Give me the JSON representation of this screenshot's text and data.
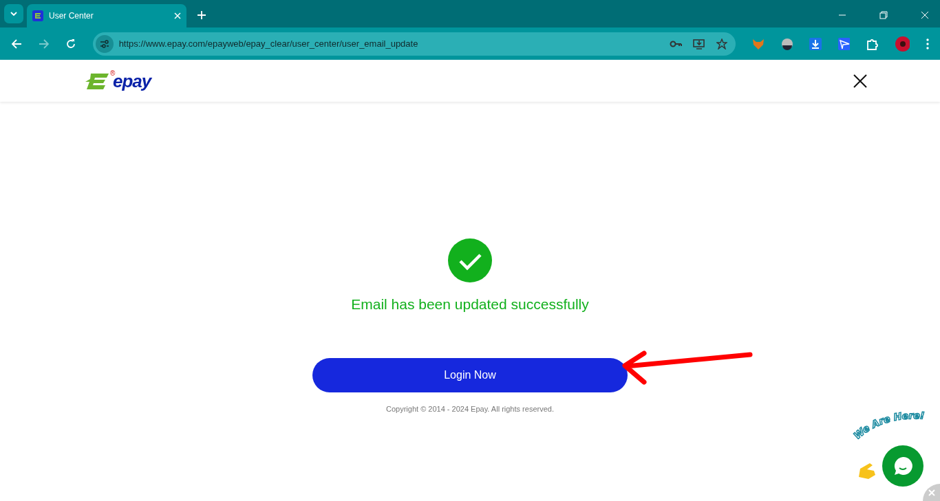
{
  "browser": {
    "tab": {
      "title": "User Center",
      "selected": true
    },
    "url": "https://www.epay.com/epayweb/epay_clear/user_center/user_email_update"
  },
  "header": {
    "logo_text": "epay",
    "logo_mark": "®"
  },
  "result": {
    "message": "Email has been updated successfully",
    "button": "Login Now",
    "copyright": "Copyright © 2014 - 2024 Epay. All rights reserved."
  },
  "chat_widget": {
    "caption": "We Are Here!"
  }
}
